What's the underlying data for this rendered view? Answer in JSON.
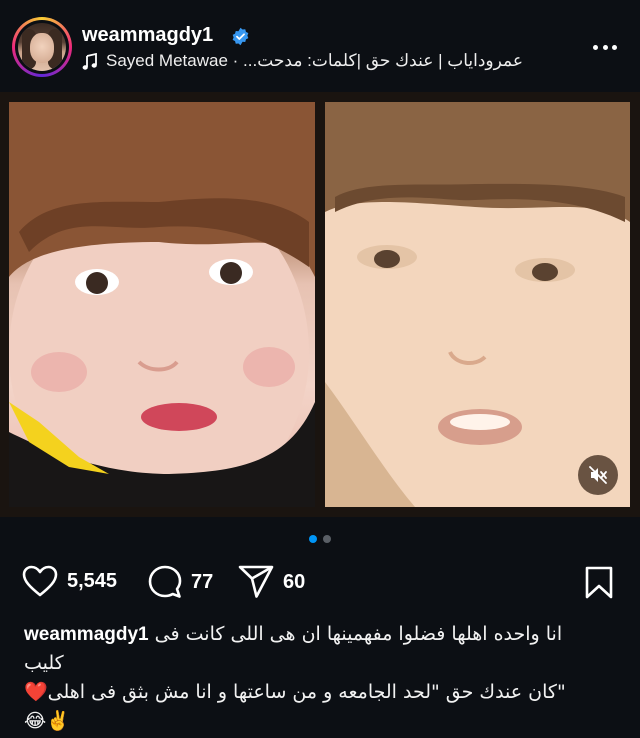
{
  "post": {
    "username": "weammagdy1",
    "verified": true,
    "audio_text": "عمروداياب | عندك حق |كلمات: مدحت... · Sayed Metawae",
    "audio_artist": "Sayed Metawae",
    "audio_title": "عمروداياب | عندك حق |كلمات: مدحت... ·"
  },
  "media": {
    "left_photo": "child-photo",
    "right_photo": "child-video-frame",
    "sound": "muted",
    "slide_count": 2,
    "active_slide": 1
  },
  "actions": {
    "likes": "5,545",
    "comments": "77",
    "shares": "60"
  },
  "caption": {
    "username": "weammagdy1",
    "line1": "انا واحده اهلها فضلوا مفهمينها ان هى اللى كانت فى",
    "line2": "كليب",
    "line3": "\"كان عندك حق \"لحد الجامعه و من ساعتها و انا مش بثق فى اهلى❤️",
    "line4": "😂✌️"
  },
  "colors": {
    "background": "#0c0f14",
    "accent_blue": "#0095f6",
    "verified_blue": "#3797f0"
  }
}
